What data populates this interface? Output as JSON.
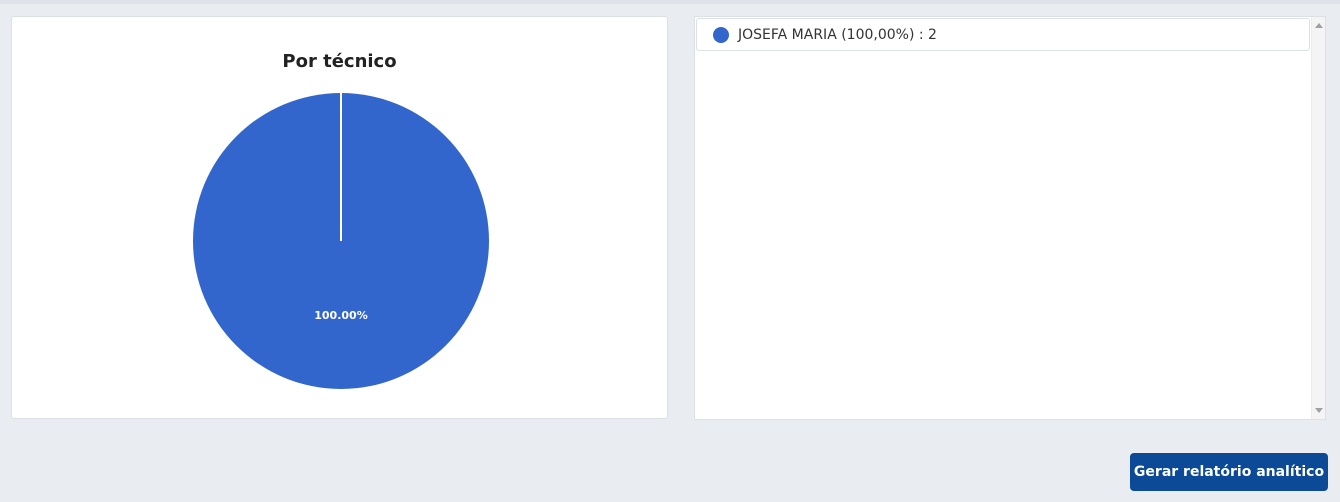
{
  "chart_data": {
    "type": "pie",
    "title": "Por técnico",
    "categories": [
      "JOSEFA MARIA"
    ],
    "values": [
      2
    ],
    "percent_labels": [
      "100.00%"
    ],
    "colors": [
      "#3366cc"
    ]
  },
  "legend": {
    "items": [
      {
        "label": "JOSEFA MARIA (100,00%) : 2",
        "color": "#3366cc"
      }
    ]
  },
  "actions": {
    "report_button_label": "Gerar relatório analítico"
  },
  "theme": {
    "accent": "#0c4a97",
    "slice_color": "#3366cc"
  }
}
